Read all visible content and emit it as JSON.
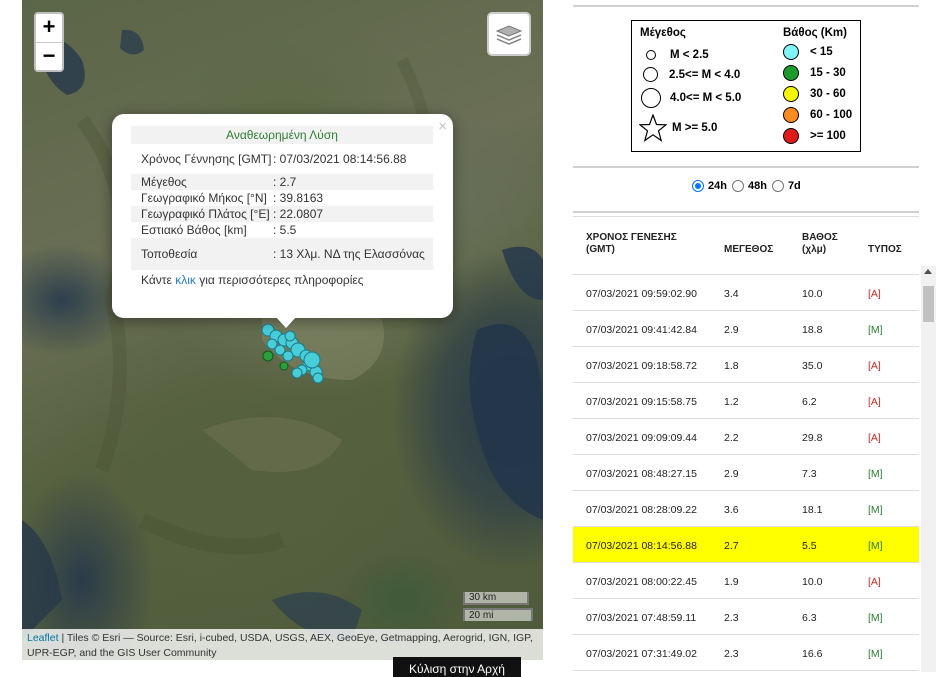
{
  "map": {
    "zoom_in": "+",
    "zoom_out": "−",
    "layers_icon": "layers-icon",
    "scale": {
      "km": "30 km",
      "mi": "20 mi"
    },
    "attribution": {
      "leaflet": "Leaflet",
      "text": " | Tiles © Esri — Source: Esri, i-cubed, USDA, USGS, AEX, GeoEye, Getmapping, Aerogrid, IGN, IGP, UPR-EGP, and the GIS User Community"
    },
    "popup": {
      "close": "×",
      "title": "Αναθεωρημένη Λύση",
      "rows": [
        {
          "label": "Χρόνος Γέννησης [GMT]",
          "value": ": 07/03/2021 08:14:56.88"
        },
        {
          "label": "Μέγεθος",
          "value": ": 2.7"
        },
        {
          "label": "Γεωγραφικό Μήκος [°N]",
          "value": ": 39.8163"
        },
        {
          "label": "Γεωγραφικό Πλάτος [°E]",
          "value": ": 22.0807"
        },
        {
          "label": "Εστιακό Βάθος [km]",
          "value": ": 5.5"
        },
        {
          "label": "Τοποθεσία",
          "value": ": 13 Χλμ. ΝΔ της Ελασσόνας"
        }
      ],
      "more_prefix": "Κάντε ",
      "more_link": "κλικ",
      "more_suffix": " για περισσότερες πληροφορίες"
    },
    "bottom_button": "Κύλιση στην Αρχή"
  },
  "legend": {
    "magnitude_title": "Μέγεθος",
    "depth_title": "Βάθος (Km)",
    "magnitude": [
      "M < 2.5",
      "2.5<= M < 4.0",
      "4.0<= M < 5.0",
      "M >= 5.0"
    ],
    "depth": [
      {
        "label": "< 15",
        "color": "#7ff5f5"
      },
      {
        "label": "15 - 30",
        "color": "#1f9a2e"
      },
      {
        "label": "30 - 60",
        "color": "#f5f500"
      },
      {
        "label": "60 - 100",
        "color": "#ff8a1f"
      },
      {
        "label": ">= 100",
        "color": "#e01a1a"
      }
    ]
  },
  "filters": {
    "options": [
      "24h",
      "48h",
      "7d"
    ],
    "selected": "24h"
  },
  "table": {
    "headers": {
      "time": "ΧΡΟΝΟΣ ΓΕΝΕΣΗΣ",
      "time2": "(GMT)",
      "mag": "ΜΕΓΕΘΟΣ",
      "depth": "ΒΑΘΟΣ",
      "depth2": "(χλμ)",
      "type": "ΤΥΠΟΣ"
    },
    "rows": [
      {
        "time": "07/03/2021 09:59:02.90",
        "mag": "3.4",
        "depth": "10.0",
        "type": "[A]"
      },
      {
        "time": "07/03/2021 09:41:42.84",
        "mag": "2.9",
        "depth": "18.8",
        "type": "[M]"
      },
      {
        "time": "07/03/2021 09:18:58.72",
        "mag": "1.8",
        "depth": "35.0",
        "type": "[A]"
      },
      {
        "time": "07/03/2021 09:15:58.75",
        "mag": "1.2",
        "depth": "6.2",
        "type": "[A]"
      },
      {
        "time": "07/03/2021 09:09:09.44",
        "mag": "2.2",
        "depth": "29.8",
        "type": "[A]"
      },
      {
        "time": "07/03/2021 08:48:27.15",
        "mag": "2.9",
        "depth": "7.3",
        "type": "[M]"
      },
      {
        "time": "07/03/2021 08:28:09.22",
        "mag": "3.6",
        "depth": "18.1",
        "type": "[M]"
      },
      {
        "time": "07/03/2021 08:14:56.88",
        "mag": "2.7",
        "depth": "5.5",
        "type": "[M]",
        "highlighted": true
      },
      {
        "time": "07/03/2021 08:00:22.45",
        "mag": "1.9",
        "depth": "10.0",
        "type": "[A]"
      },
      {
        "time": "07/03/2021 07:48:59.11",
        "mag": "2.3",
        "depth": "6.3",
        "type": "[M]"
      },
      {
        "time": "07/03/2021 07:31:49.02",
        "mag": "2.3",
        "depth": "16.6",
        "type": "[M]"
      }
    ]
  }
}
